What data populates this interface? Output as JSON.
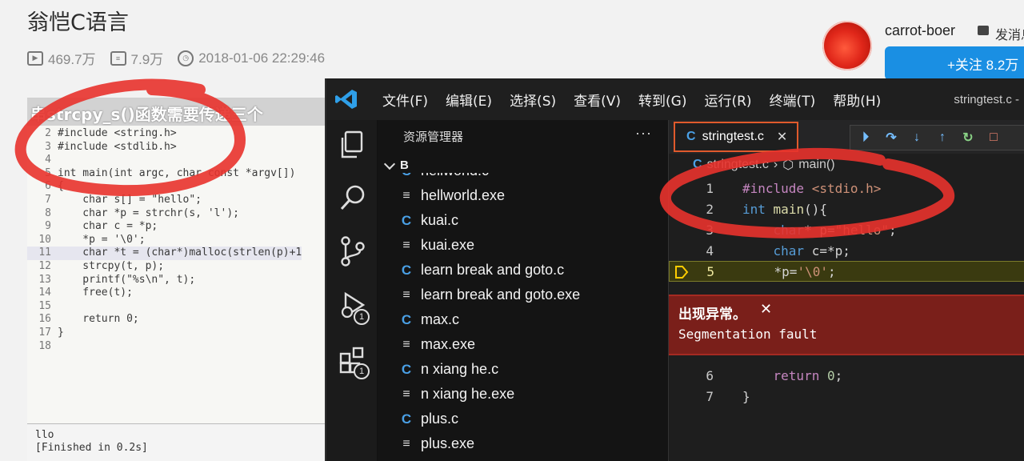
{
  "page": {
    "title": "翁恺C语言",
    "stats": {
      "plays": "469.7万",
      "danmaku": "7.9万",
      "date": "2018-01-06 22:29:46"
    },
    "uploader": {
      "name": "carrot-boer",
      "send_message": "发消息",
      "follow_label": "+关注 8.2万"
    }
  },
  "sublime": {
    "banner": "串strcpy_s()函数需要传递三个",
    "lines": [
      {
        "n": "2",
        "text": "#include <string.h>"
      },
      {
        "n": "3",
        "text": "#include <stdlib.h>"
      },
      {
        "n": "4",
        "text": ""
      },
      {
        "n": "5",
        "text": "int main(int argc, char const *argv[])"
      },
      {
        "n": "6",
        "text": "{"
      },
      {
        "n": "7",
        "text": "    char s[] = \"hello\";"
      },
      {
        "n": "8",
        "text": "    char *p = strchr(s, 'l');"
      },
      {
        "n": "9",
        "text": "    char c = *p;"
      },
      {
        "n": "10",
        "text": "    *p = '\\0';"
      },
      {
        "n": "11",
        "text": "    char *t = (char*)malloc(strlen(p)+1"
      },
      {
        "n": "12",
        "text": "    strcpy(t, p);"
      },
      {
        "n": "13",
        "text": "    printf(\"%s\\n\", t);"
      },
      {
        "n": "14",
        "text": "    free(t);"
      },
      {
        "n": "15",
        "text": ""
      },
      {
        "n": "16",
        "text": "    return 0;"
      },
      {
        "n": "17",
        "text": "}"
      },
      {
        "n": "18",
        "text": ""
      }
    ],
    "output_line1": "llo",
    "output_line2": "[Finished in 0.2s]"
  },
  "vscode": {
    "menu": [
      "文件(F)",
      "编辑(E)",
      "选择(S)",
      "查看(V)",
      "转到(G)",
      "运行(R)",
      "终端(T)",
      "帮助(H)"
    ],
    "window_title": "stringtest.c -",
    "explorer_title": "资源管理器",
    "folder": "B",
    "files": [
      {
        "name": "hellworld.c",
        "type": "c"
      },
      {
        "name": "hellworld.exe",
        "type": "exe"
      },
      {
        "name": "kuai.c",
        "type": "c"
      },
      {
        "name": "kuai.exe",
        "type": "exe"
      },
      {
        "name": "learn break and goto.c",
        "type": "c"
      },
      {
        "name": "learn break and goto.exe",
        "type": "exe"
      },
      {
        "name": "max.c",
        "type": "c"
      },
      {
        "name": "max.exe",
        "type": "exe"
      },
      {
        "name": "n xiang he.c",
        "type": "c"
      },
      {
        "name": "n xiang he.exe",
        "type": "exe"
      },
      {
        "name": "plus.c",
        "type": "c"
      },
      {
        "name": "plus.exe",
        "type": "exe"
      }
    ],
    "tab": "stringtest.c",
    "breadcrumb_file": "stringtest.c",
    "breadcrumb_symbol": "main()",
    "badges": {
      "run_debug": "1",
      "extensions": "1"
    },
    "exception_title": "出现异常。",
    "exception_message": "Segmentation fault"
  },
  "colors": {
    "accent_follow": "#1a8fe3",
    "tab_border": "#e05a2c",
    "exception_bg": "#7a1f1a",
    "annotation_red": "#e8322c"
  }
}
